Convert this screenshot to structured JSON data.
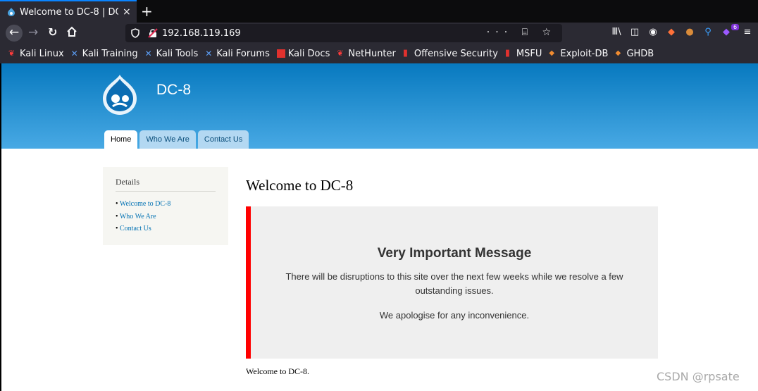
{
  "browser": {
    "tab_title": "Welcome to DC-8 | DC-",
    "tab_close": "×",
    "new_tab": "+",
    "url": "192.168.119.169",
    "url_actions": "··· ⌸ ☆",
    "addon_badge": "6"
  },
  "bookmarks": [
    {
      "label": "Kali Linux",
      "icon": "kali-dragon-icon",
      "color": "#ff3b3b"
    },
    {
      "label": "Kali Training",
      "icon": "kali-tools-icon",
      "color": "#3a7bd5"
    },
    {
      "label": "Kali Tools",
      "icon": "kali-tools-icon",
      "color": "#3a7bd5"
    },
    {
      "label": "Kali Forums",
      "icon": "kali-tools-icon",
      "color": "#3a7bd5"
    },
    {
      "label": "Kali Docs",
      "icon": "docs-icon",
      "color": "#e0312e"
    },
    {
      "label": "NetHunter",
      "icon": "kali-dragon-icon",
      "color": "#ff3b3b"
    },
    {
      "label": "Offensive Security",
      "icon": "offsec-icon",
      "color": "#e0312e"
    },
    {
      "label": "MSFU",
      "icon": "offsec-icon",
      "color": "#e0312e"
    },
    {
      "label": "Exploit-DB",
      "icon": "exploitdb-icon",
      "color": "#f08b30"
    },
    {
      "label": "GHDB",
      "icon": "exploitdb-icon",
      "color": "#f08b30"
    }
  ],
  "site": {
    "name": "DC-8",
    "tabs": [
      {
        "label": "Home",
        "active": true
      },
      {
        "label": "Who We Are",
        "active": false
      },
      {
        "label": "Contact Us",
        "active": false
      }
    ],
    "sidebar": {
      "title": "Details",
      "links": [
        "Welcome to DC-8",
        "Who We Are",
        "Contact Us"
      ]
    },
    "page_title": "Welcome to DC-8",
    "notice": {
      "title": "Very Important Message",
      "body": "There will be disruptions to this site over the next few weeks while we resolve a few outstanding issues.",
      "body2": "We apologise for any inconvenience.",
      "accent_color": "#ff0000"
    },
    "footer_text": "Welcome to DC-8."
  },
  "watermark": "CSDN @rpsate",
  "colors": {
    "header_top": "#0779bf",
    "header_bottom": "#48a9e4",
    "link": "#0071b3"
  }
}
